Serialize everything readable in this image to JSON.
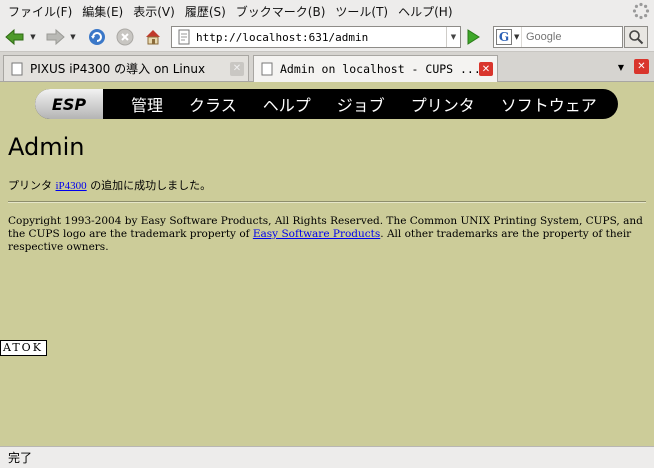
{
  "menubar": {
    "items": [
      "ファイル(F)",
      "編集(E)",
      "表示(V)",
      "履歴(S)",
      "ブックマーク(B)",
      "ツール(T)",
      "ヘルプ(H)"
    ]
  },
  "toolbar": {
    "url": "http://localhost:631/admin",
    "search_placeholder": "Google",
    "search_engine_letter": "G"
  },
  "tabs": [
    {
      "title": "PIXUS iP4300 の導入 on Linux",
      "active": false
    },
    {
      "title": "Admin on localhost - CUPS ...",
      "active": true
    }
  ],
  "cups": {
    "logo": "ESP",
    "nav": [
      "管理",
      "クラス",
      "ヘルプ",
      "ジョブ",
      "プリンタ",
      "ソフトウェア"
    ],
    "heading": "Admin",
    "message_prefix": "プリンタ",
    "printer_link": "iP4300",
    "message_suffix": "の追加に成功しました。",
    "copyright_part1": "Copyright 1993-2004 by Easy Software Products, All Rights Reserved. The Common UNIX Printing System, CUPS, and the CUPS logo are the trademark property of ",
    "copyright_link": "Easy Software Products",
    "copyright_part2": ". All other trademarks are the property of their respective owners."
  },
  "ime": "ATOK",
  "status": "完了"
}
